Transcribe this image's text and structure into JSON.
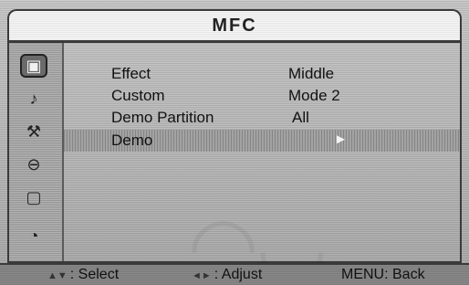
{
  "window": {
    "title": "MFC"
  },
  "sidebar": {
    "items": [
      {
        "icon": "tv-picture-icon",
        "glyph": "▣",
        "active": true
      },
      {
        "icon": "sound-icon",
        "glyph": "♪",
        "active": false
      },
      {
        "icon": "setup-tools-icon",
        "glyph": "⚒",
        "active": false
      },
      {
        "icon": "lock-icon",
        "glyph": "⊖",
        "active": false
      },
      {
        "icon": "screen-icon",
        "glyph": "▢",
        "active": false
      },
      {
        "icon": "satellite-dish-icon",
        "glyph": "◔",
        "active": false
      }
    ]
  },
  "menu": {
    "items": [
      {
        "label": "Effect",
        "value": "Middle"
      },
      {
        "label": "Custom",
        "value": "Mode 2"
      },
      {
        "label": "Demo Partition",
        "value": "All"
      },
      {
        "label": "Demo",
        "value": "►",
        "selected": true
      }
    ]
  },
  "help": {
    "select_keys": "▲▼",
    "select": ": Select",
    "adjust_keys": "◄►",
    "adjust": ": Adjust",
    "back": "MENU: Back"
  }
}
